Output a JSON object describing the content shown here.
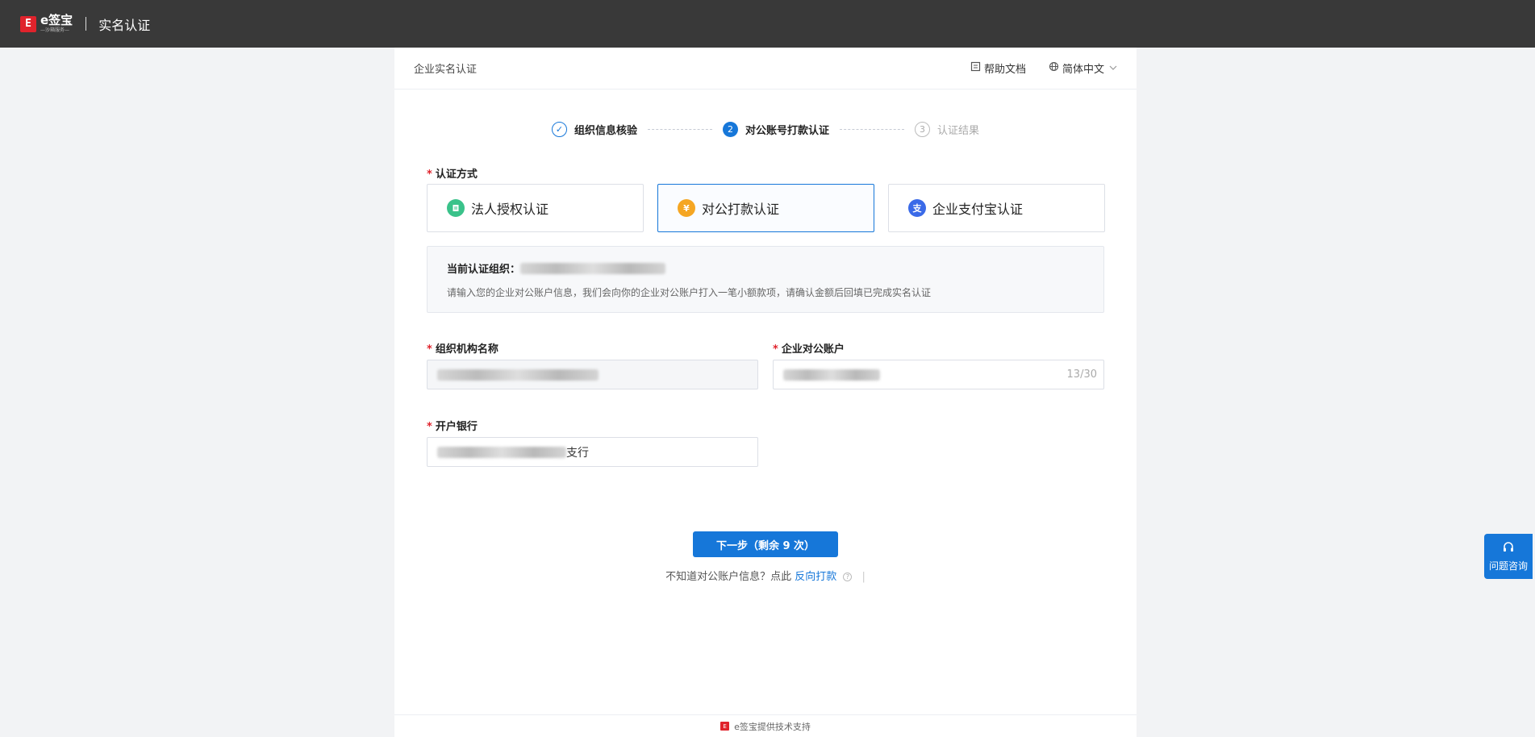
{
  "topbar": {
    "logo_mark": "E",
    "logo_name": "e签宝",
    "logo_sub": "—沙箱服务—",
    "title": "实名认证"
  },
  "card": {
    "title": "企业实名认证",
    "help_label": "帮助文档",
    "language_label": "简体中文"
  },
  "steps": [
    {
      "num": "✓",
      "label": "组织信息核验",
      "state": "done"
    },
    {
      "num": "2",
      "label": "对公账号打款认证",
      "state": "active"
    },
    {
      "num": "3",
      "label": "认证结果",
      "state": "todo"
    }
  ],
  "method": {
    "label": "认证方式",
    "options": [
      {
        "label": "法人授权认证",
        "icon": "document-icon",
        "color": "#3ac28a"
      },
      {
        "label": "对公打款认证",
        "icon": "yen-icon",
        "color": "#f5a623",
        "selected": true
      },
      {
        "label": "企业支付宝认证",
        "icon": "alipay-icon",
        "color": "#3a6ae8"
      }
    ]
  },
  "info": {
    "title_prefix": "当前认证组织：",
    "description": "请输入您的企业对公账户信息，我们会向你的企业对公账户打入一笔小额款项，请确认金额后回填已完成实名认证"
  },
  "form": {
    "org_name_label": "组织机构名称",
    "account_label": "企业对公账户",
    "account_counter": "13/30",
    "bank_label": "开户银行",
    "bank_value_suffix": "支行"
  },
  "actions": {
    "next_label": "下一步（剩余 9 次）",
    "hint_prefix": "不知道对公账户信息？点此",
    "hint_link": "反向打款",
    "hint_bar": "|"
  },
  "footer": {
    "text": "e签宝提供技术支持"
  },
  "consult": {
    "label": "问题咨询"
  },
  "colors": {
    "primary": "#1677d9",
    "topbar": "#393939",
    "required": "#e0232c"
  }
}
